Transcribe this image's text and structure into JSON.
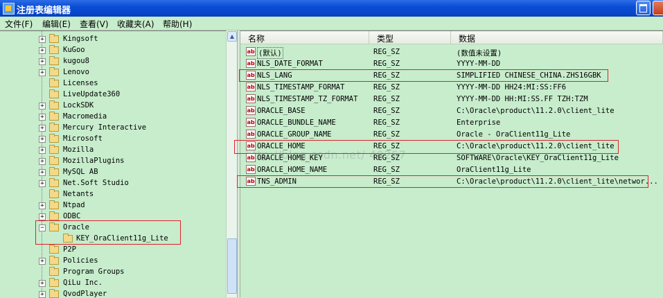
{
  "window": {
    "title": "注册表编辑器"
  },
  "menu": [
    {
      "label": "文件(F)"
    },
    {
      "label": "编辑(E)"
    },
    {
      "label": "查看(V)"
    },
    {
      "label": "收藏夹(A)"
    },
    {
      "label": "帮助(H)"
    }
  ],
  "tree": {
    "items": [
      {
        "label": "Kingsoft",
        "expander": "+"
      },
      {
        "label": "KuGoo",
        "expander": "+"
      },
      {
        "label": "kugou8",
        "expander": "+"
      },
      {
        "label": "Lenovo",
        "expander": "+"
      },
      {
        "label": "Licenses",
        "expander": ""
      },
      {
        "label": "LiveUpdate360",
        "expander": ""
      },
      {
        "label": "LockSDK",
        "expander": "+"
      },
      {
        "label": "Macromedia",
        "expander": "+"
      },
      {
        "label": "Mercury Interactive",
        "expander": "+"
      },
      {
        "label": "Microsoft",
        "expander": "+"
      },
      {
        "label": "Mozilla",
        "expander": "+"
      },
      {
        "label": "MozillaPlugins",
        "expander": "+"
      },
      {
        "label": "MySQL AB",
        "expander": "+"
      },
      {
        "label": "Net.Soft Studio",
        "expander": "+"
      },
      {
        "label": "Netants",
        "expander": ""
      },
      {
        "label": "Ntpad",
        "expander": "+"
      },
      {
        "label": "ODBC",
        "expander": "+"
      },
      {
        "label": "Oracle",
        "expander": "−"
      },
      {
        "label": "KEY_OraClient11g_Lite",
        "expander": "",
        "child": true
      },
      {
        "label": "P2P",
        "expander": ""
      },
      {
        "label": "Policies",
        "expander": "+"
      },
      {
        "label": "Program Groups",
        "expander": ""
      },
      {
        "label": "QiLu Inc.",
        "expander": "+"
      },
      {
        "label": "QvodPlayer",
        "expander": "+"
      }
    ]
  },
  "columns": {
    "name": "名称",
    "type": "类型",
    "data": "数据"
  },
  "values": [
    {
      "name": "(默认)",
      "type": "REG_SZ",
      "data": "(数值未设置)",
      "default": true
    },
    {
      "name": "NLS_DATE_FORMAT",
      "type": "REG_SZ",
      "data": "YYYY-MM-DD"
    },
    {
      "name": "NLS_LANG",
      "type": "REG_SZ",
      "data": "SIMPLIFIED CHINESE_CHINA.ZHS16GBK"
    },
    {
      "name": "NLS_TIMESTAMP_FORMAT",
      "type": "REG_SZ",
      "data": "YYYY-MM-DD HH24:MI:SS:FF6"
    },
    {
      "name": "NLS_TIMESTAMP_TZ_FORMAT",
      "type": "REG_SZ",
      "data": "YYYY-MM-DD HH:MI:SS.FF TZH:TZM"
    },
    {
      "name": "ORACLE_BASE",
      "type": "REG_SZ",
      "data": "C:\\Oracle\\product\\11.2.0\\client_lite"
    },
    {
      "name": "ORACLE_BUNDLE_NAME",
      "type": "REG_SZ",
      "data": "Enterprise"
    },
    {
      "name": "ORACLE_GROUP_NAME",
      "type": "REG_SZ",
      "data": "Oracle - OraClient11g_Lite"
    },
    {
      "name": "ORACLE_HOME",
      "type": "REG_SZ",
      "data": "C:\\Oracle\\product\\11.2.0\\client_lite"
    },
    {
      "name": "ORACLE_HOME_KEY",
      "type": "REG_SZ",
      "data": "SOFTWARE\\Oracle\\KEY_OraClient11g_Lite"
    },
    {
      "name": "ORACLE_HOME_NAME",
      "type": "REG_SZ",
      "data": "OraClient11g_Lite"
    },
    {
      "name": "TNS_ADMIN",
      "type": "REG_SZ",
      "data": "C:\\Oracle\\product\\11.2.0\\client_lite\\networ..."
    }
  ],
  "string_value_icon": "ab",
  "watermark": "http://blog.csdn.net/   40257",
  "colors": {
    "highlight_box": "#E0202A",
    "background": "#C7EDCC",
    "titlebar": "#0A4ED6"
  }
}
